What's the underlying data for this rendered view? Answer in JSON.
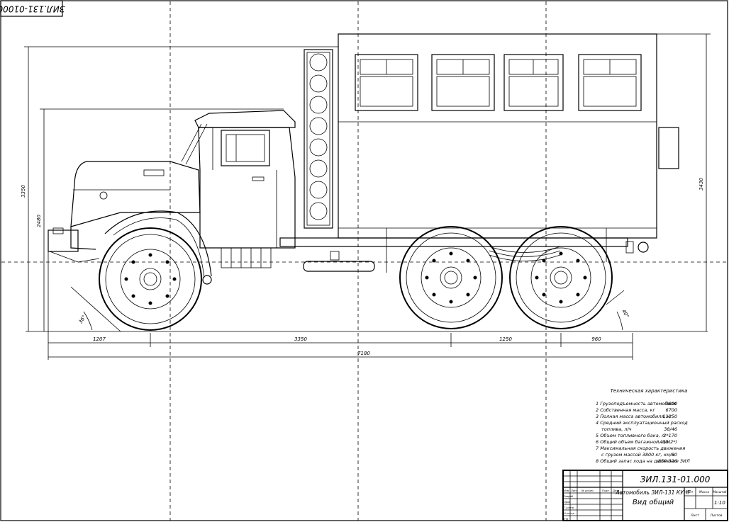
{
  "stamp_rotated": "ЗИЛ.131-01000",
  "dimensions": {
    "h_total": "3350",
    "h_cab": "2480",
    "h_body": "3430",
    "front_overhang": "1207",
    "wheelbase": "3350",
    "rear_bogie": "1250",
    "rear_overhang": "960",
    "overall_length": "7180",
    "approach_angle": "36°",
    "departure_angle": "40°"
  },
  "specs": {
    "title": "Техническая характеристика",
    "items": [
      {
        "label": "1 Грузоподъемность автомобиля",
        "value": "3800"
      },
      {
        "label": "2 Собственная масса, кг",
        "value": "6700"
      },
      {
        "label": "3 Полная масса автомобиля, кг",
        "value": "11150"
      },
      {
        "label": "4 Средний эксплуатационный расход",
        "value": ""
      },
      {
        "label": "топлива, л/ч",
        "value": "38/46"
      },
      {
        "label": "5 Объем топливного бака, л",
        "value": "2*170"
      },
      {
        "label": "6 Общий объем багажной, л/м",
        "value": "400(2*)"
      },
      {
        "label": "7 Максимальная скорость движения",
        "value": ""
      },
      {
        "label": "с грузом массой 3800 кг, км/ч",
        "value": "80"
      },
      {
        "label": "8 Общий запас хода на движение ЗИЛ",
        "value": "850-320"
      }
    ]
  },
  "titleblock": {
    "code": "ЗИЛ.131-01.000",
    "name_line1": "Автомобиль ЗИЛ-131 КУНГ",
    "name_line2": "Вид общий",
    "col_lit": "Лит",
    "col_mass": "Масса",
    "col_scale": "Масштаб",
    "scale": "1:10",
    "sheet": "Лист",
    "sheets": "Листов",
    "rows": [
      {
        "a": "Изм",
        "b": "Лист",
        "c": "№ докум",
        "d": "Подп",
        "e": "Дата"
      },
      {
        "a": "Разраб",
        "b": "",
        "c": "",
        "d": "",
        "e": ""
      },
      {
        "a": "Пров",
        "b": "",
        "c": "",
        "d": "",
        "e": ""
      },
      {
        "a": "Т.контр",
        "b": "",
        "c": "",
        "d": "",
        "e": ""
      },
      {
        "a": "Н.контр",
        "b": "",
        "c": "",
        "d": "",
        "e": ""
      },
      {
        "a": "Утв",
        "b": "",
        "c": "",
        "d": "",
        "e": ""
      }
    ]
  }
}
